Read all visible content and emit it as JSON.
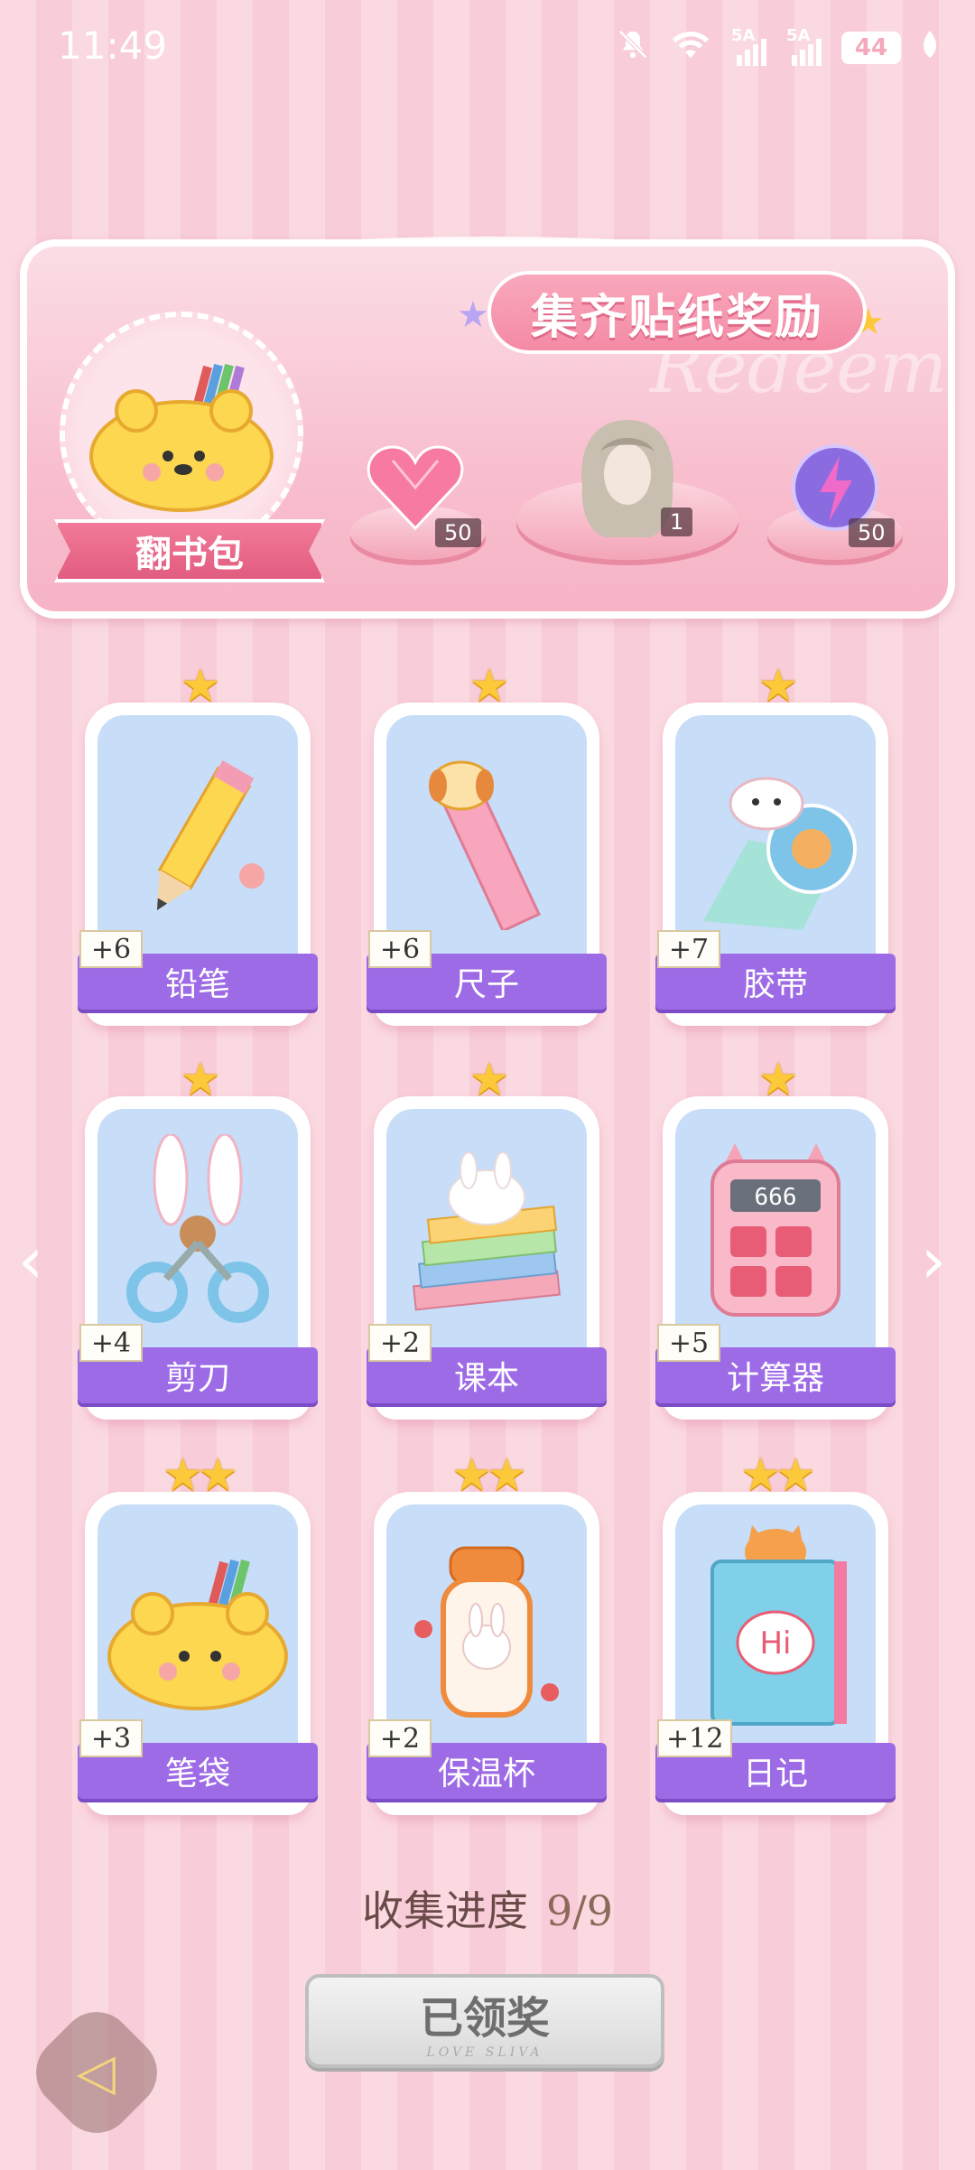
{
  "status": {
    "time": "11:49",
    "signal1": "5A",
    "signal2": "5A",
    "battery": "44"
  },
  "banner": {
    "title": "集齐贴纸奖励",
    "watermark": "Redeem",
    "bag_label": "翻书包",
    "rewards": [
      {
        "name": "heart-gem",
        "qty": "50"
      },
      {
        "name": "hair-avatar",
        "qty": "1"
      },
      {
        "name": "lightning-orb",
        "qty": "50"
      }
    ]
  },
  "cards": [
    {
      "name": "铅笔",
      "plus": "+6",
      "stars": "★"
    },
    {
      "name": "尺子",
      "plus": "+6",
      "stars": "★"
    },
    {
      "name": "胶带",
      "plus": "+7",
      "stars": "★"
    },
    {
      "name": "剪刀",
      "plus": "+4",
      "stars": "★"
    },
    {
      "name": "课本",
      "plus": "+2",
      "stars": "★"
    },
    {
      "name": "计算器",
      "plus": "+5",
      "stars": "★",
      "screen": "666"
    },
    {
      "name": "笔袋",
      "plus": "+3",
      "stars": "★★"
    },
    {
      "name": "保温杯",
      "plus": "+2",
      "stars": "★★"
    },
    {
      "name": "日记",
      "plus": "+12",
      "stars": "★★",
      "book_text": "Hi"
    }
  ],
  "progress": {
    "label": "收集进度",
    "value": "9/9"
  },
  "claim_button": {
    "label": "已领奖",
    "sub": "LOVE SLIVA"
  },
  "colors": {
    "accent": "#9e6be6",
    "banner": "#f48aa5",
    "background": "#fbd9e1"
  }
}
